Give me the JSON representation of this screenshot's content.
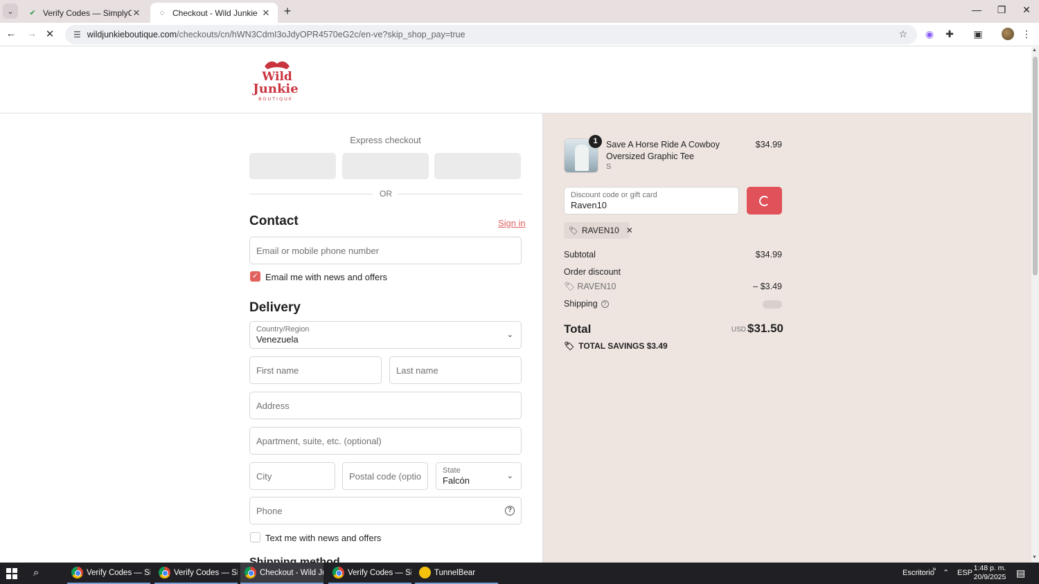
{
  "browser": {
    "tabs": [
      {
        "title": "Verify Codes — SimplyCodes",
        "active": false
      },
      {
        "title": "Checkout - Wild Junkie",
        "active": true
      }
    ],
    "url_host": "wildjunkieboutique.com",
    "url_path": "/checkouts/cn/hWN3CdmI3oJdyOPR4570eG2c/en-ve?skip_shop_pay=true",
    "icons": {
      "back": "arrow-left-icon",
      "forward": "arrow-right-icon",
      "reload": "stop-loading-icon"
    }
  },
  "store": {
    "logo_text_1": "Wild",
    "logo_text_2": "Junkie",
    "logo_sub": "BOUTIQUE"
  },
  "express": {
    "title": "Express checkout",
    "or": "OR"
  },
  "contact": {
    "heading": "Contact",
    "sign_in": "Sign in",
    "email_placeholder": "Email or mobile phone number",
    "news_label": "Email me with news and offers",
    "news_checked": true
  },
  "delivery": {
    "heading": "Delivery",
    "country_label": "Country/Region",
    "country_value": "Venezuela",
    "first_name": "First name",
    "last_name": "Last name",
    "address": "Address",
    "apartment": "Apartment, suite, etc. (optional)",
    "city": "City",
    "postal": "Postal code (optional)",
    "state_label": "State",
    "state_value": "Falcón",
    "phone": "Phone",
    "sms_label": "Text me with news and offers",
    "shipping_heading": "Shipping method"
  },
  "summary": {
    "item": {
      "qty": "1",
      "name": "Save A Horse Ride A Cowboy Oversized Graphic Tee",
      "variant": "S",
      "price": "$34.99"
    },
    "discount_label": "Discount code or gift card",
    "discount_value": "Raven10",
    "applied_code": "RAVEN10",
    "subtotal_label": "Subtotal",
    "subtotal": "$34.99",
    "order_discount_label": "Order discount",
    "discount_code": "RAVEN10",
    "discount_amount": "– $3.49",
    "shipping_label": "Shipping",
    "total_label": "Total",
    "currency": "USD",
    "total": "$31.50",
    "savings": "TOTAL SAVINGS  $3.49",
    "accent_color": "#e0515a"
  },
  "taskbar": {
    "apps": [
      {
        "name": "Verify Codes — Sim...",
        "active": false
      },
      {
        "name": "Verify Codes — Sim...",
        "active": false
      },
      {
        "name": "Checkout - Wild Ju...",
        "active": true
      },
      {
        "name": "Verify Codes — Sim...",
        "active": false
      },
      {
        "name": "TunnelBear",
        "active": false
      }
    ],
    "desktop": "Escritorio",
    "lang": "ESP",
    "time": "1:48 p. m.",
    "date": "20/9/2025"
  }
}
